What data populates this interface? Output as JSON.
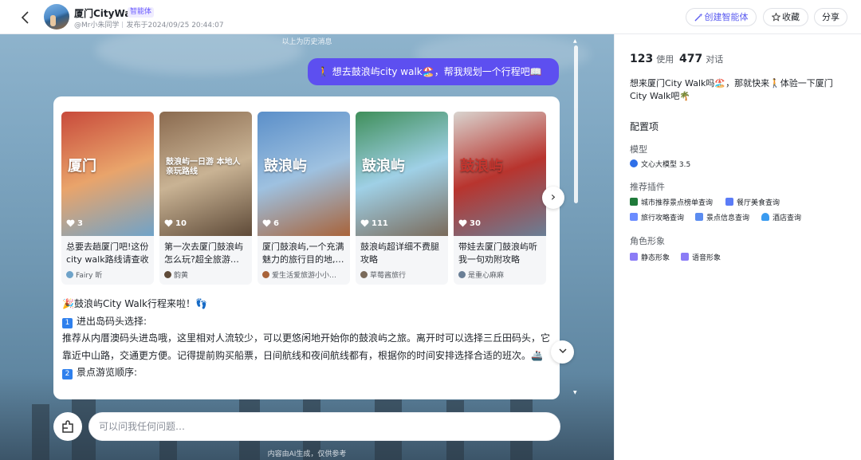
{
  "header": {
    "title": "厦门CityWalk",
    "badge": "智能体",
    "author": "@Mr小朱同学",
    "published": "发布于2024/09/25 20:44:07",
    "create_label": "创建智能体",
    "fav_label": "收藏",
    "share_label": "分享"
  },
  "chat": {
    "history_hint": "以上为历史消息",
    "user_message": "🚶 想去鼓浪屿city walk🏖️，帮我规划一个行程吧📖",
    "notes": [
      {
        "likes": "3",
        "title": "总要去趟厦门吧!这份city walk路线请查收",
        "author": "Fairy 昕",
        "overlay": "厦门",
        "palette": [
          "#c84a3b",
          "#e9a46b",
          "#6fa3c9"
        ]
      },
      {
        "likes": "10",
        "title": "第一次去厦门鼓浪屿怎么玩?超全旅游…",
        "author": "韵黄",
        "overlay": "鼓浪屿一日游 本地人亲玩路线",
        "palette": [
          "#8a6a4f",
          "#c9b394",
          "#5e4a38"
        ]
      },
      {
        "likes": "6",
        "title": "厦门鼓浪屿,一个充满魅力的旅行目的地,…",
        "author": "爱生活爱旅游小小…",
        "overlay": "鼓浪屿",
        "palette": [
          "#5b8fc9",
          "#9ec1e0",
          "#a8633a"
        ]
      },
      {
        "likes": "111",
        "title": "鼓浪屿超详细不费腿攻略",
        "author": "草莓酱旅行",
        "overlay": "鼓浪屿",
        "palette": [
          "#3f8f5a",
          "#9fd0e6",
          "#7a6a5a"
        ]
      },
      {
        "likes": "30",
        "title": "带娃去厦门鼓浪屿听我一句劝附攻略",
        "author": "是重心麻麻",
        "overlay": "鼓浪屿",
        "palette": [
          "#d9d4cf",
          "#b8342e",
          "#6a7f96"
        ]
      }
    ],
    "intro": "🎉鼓浪屿City Walk行程来啦！👣",
    "step1_num": "1",
    "step1_title": "进出岛码头选择:",
    "step1_body": "推荐从内厝澳码头进岛哦，这里相对人流较少，可以更悠闲地开始你的鼓浪屿之旅。离开时可以选择三丘田码头，它靠近中山路，交通更方便。记得提前购买船票，日间航线和夜间航线都有，根据你的时间安排选择合适的班次。🚢",
    "step2_num": "2",
    "step2_title": "景点游览顺序:",
    "input_placeholder": "可以问我任何问题…",
    "disclaimer": "内容由AI生成，仅供参考"
  },
  "sidebar": {
    "uses_count": "123",
    "uses_label": "使用",
    "chats_count": "477",
    "chats_label": "对话",
    "description": "想来厦门City Walk吗🏖️，那就快来🚶体验一下厦门City Walk吧🌴",
    "config_title": "配置项",
    "model_label": "模型",
    "model_name": "文心大模型 3.5",
    "plugins_label": "推荐插件",
    "plugins": [
      "城市推荐景点榜单查询",
      "餐厅美食查询",
      "旅行攻略查询",
      "景点信息查询",
      "酒店查询"
    ],
    "persona_label": "角色形象",
    "persona": [
      "静态形象",
      "语音形象"
    ]
  },
  "colors": {
    "accent": "#5d4ff0",
    "badge_text": "#6b5cff",
    "number_badge": "#2f80ed"
  }
}
